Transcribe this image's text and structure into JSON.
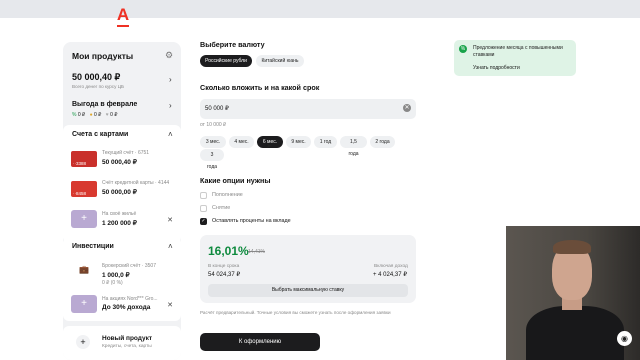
{
  "brand": {
    "logo_letter": "А",
    "color": "#ef3124"
  },
  "sidebar": {
    "title": "Мои продукты",
    "balance": {
      "amount": "50 000,40 ₽",
      "note": "Всего денег по курсу ЦБ"
    },
    "benefit": {
      "title": "Выгода в феврале",
      "items": [
        "0 ₽",
        "0 ₽",
        "0 ₽"
      ]
    },
    "cards_section": "Счета с картами",
    "accounts": [
      {
        "name": "Текущий счёт · 6751",
        "value": "50 000,40 ₽",
        "card_tag": "··3388"
      },
      {
        "name": "Счёт кредитной карты · 4144",
        "value": "50 000,00 ₽",
        "card_tag": "··8458"
      },
      {
        "name": "На своё жильё",
        "value": "1 200 000 ₽"
      }
    ],
    "investments_section": "Инвестиции",
    "investments": [
      {
        "name": "Брокерский счёт · 3507",
        "value": "1 000,0 ₽",
        "sub": "0 ₽ (0 %)"
      },
      {
        "name": "На акциях Nord*** Gro...",
        "value": "До 30% дохода"
      }
    ],
    "new_product": {
      "title": "Новый продукт",
      "sub": "Кредиты, счета, карты"
    }
  },
  "currency": {
    "title": "Выберите валюту",
    "options": [
      "Российские рубли",
      "Китайский юань"
    ],
    "selected": "Российские рубли"
  },
  "amount": {
    "title": "Сколько вложить и на какой срок",
    "value": "50 000 ₽",
    "hint": "от 10 000 ₽",
    "terms": [
      "3 мес.",
      "4 мес.",
      "6 мес.",
      "9 мес.",
      "1 год",
      "1,5 года",
      "2 года",
      "3 года"
    ],
    "selected_term": "6 мес."
  },
  "options": {
    "title": "Какие опции нужны",
    "items": [
      {
        "label": "Пополнение",
        "checked": false
      },
      {
        "label": "Снятие",
        "checked": false
      },
      {
        "label": "Оставлять проценты на вкладе",
        "checked": true
      }
    ]
  },
  "result": {
    "rate": "16,01%",
    "old_rate": "14,41%",
    "end_label": "В конце срока",
    "end_value": "54 024,37 ₽",
    "income_label": "Включая доход",
    "income_value": "+ 4 024,37 ₽",
    "max_button": "Выбрать максимальную ставку"
  },
  "disclaimer": "Расчёт предварительный. Точные условия вы сможете узнать после оформления заявки",
  "cta": "К оформлению",
  "promo": {
    "text": "Предложение месяца с повышенными ставками",
    "link": "Узнать подробности"
  }
}
